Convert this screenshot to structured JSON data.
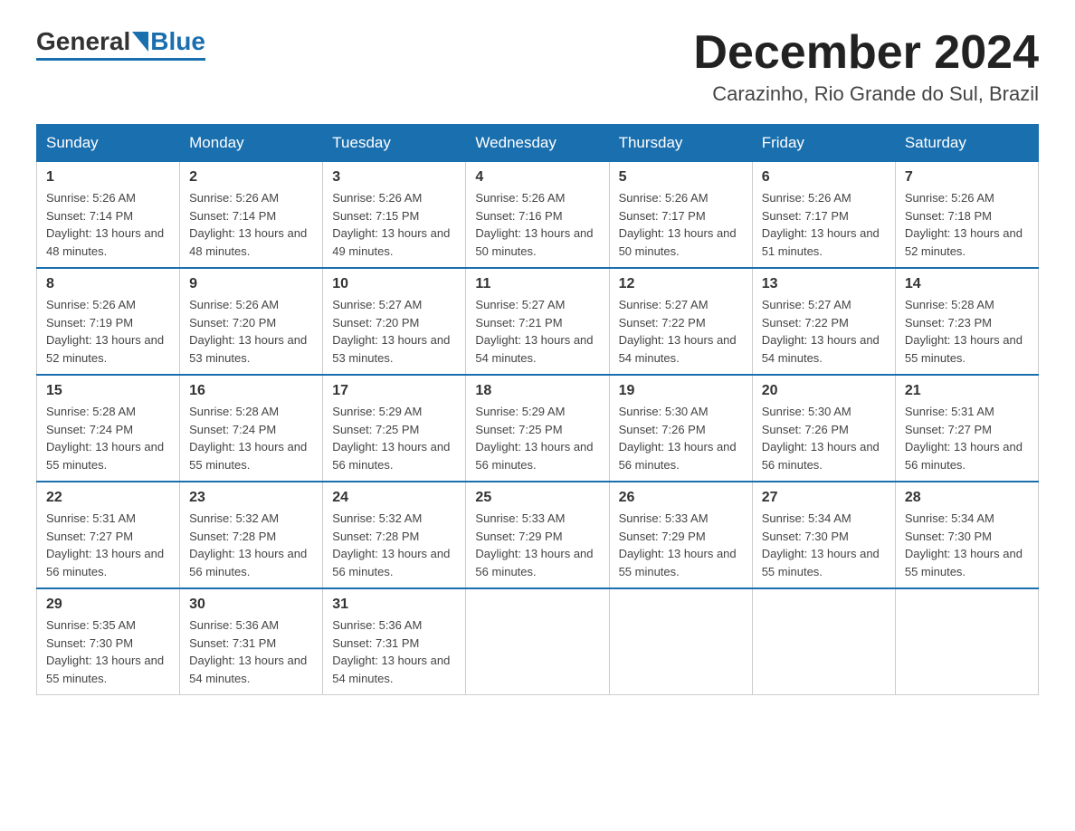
{
  "header": {
    "logo_general": "General",
    "logo_blue": "Blue",
    "month_title": "December 2024",
    "location": "Carazinho, Rio Grande do Sul, Brazil"
  },
  "days_of_week": [
    "Sunday",
    "Monday",
    "Tuesday",
    "Wednesday",
    "Thursday",
    "Friday",
    "Saturday"
  ],
  "weeks": [
    [
      {
        "num": "1",
        "sunrise": "5:26 AM",
        "sunset": "7:14 PM",
        "daylight": "13 hours and 48 minutes."
      },
      {
        "num": "2",
        "sunrise": "5:26 AM",
        "sunset": "7:14 PM",
        "daylight": "13 hours and 48 minutes."
      },
      {
        "num": "3",
        "sunrise": "5:26 AM",
        "sunset": "7:15 PM",
        "daylight": "13 hours and 49 minutes."
      },
      {
        "num": "4",
        "sunrise": "5:26 AM",
        "sunset": "7:16 PM",
        "daylight": "13 hours and 50 minutes."
      },
      {
        "num": "5",
        "sunrise": "5:26 AM",
        "sunset": "7:17 PM",
        "daylight": "13 hours and 50 minutes."
      },
      {
        "num": "6",
        "sunrise": "5:26 AM",
        "sunset": "7:17 PM",
        "daylight": "13 hours and 51 minutes."
      },
      {
        "num": "7",
        "sunrise": "5:26 AM",
        "sunset": "7:18 PM",
        "daylight": "13 hours and 52 minutes."
      }
    ],
    [
      {
        "num": "8",
        "sunrise": "5:26 AM",
        "sunset": "7:19 PM",
        "daylight": "13 hours and 52 minutes."
      },
      {
        "num": "9",
        "sunrise": "5:26 AM",
        "sunset": "7:20 PM",
        "daylight": "13 hours and 53 minutes."
      },
      {
        "num": "10",
        "sunrise": "5:27 AM",
        "sunset": "7:20 PM",
        "daylight": "13 hours and 53 minutes."
      },
      {
        "num": "11",
        "sunrise": "5:27 AM",
        "sunset": "7:21 PM",
        "daylight": "13 hours and 54 minutes."
      },
      {
        "num": "12",
        "sunrise": "5:27 AM",
        "sunset": "7:22 PM",
        "daylight": "13 hours and 54 minutes."
      },
      {
        "num": "13",
        "sunrise": "5:27 AM",
        "sunset": "7:22 PM",
        "daylight": "13 hours and 54 minutes."
      },
      {
        "num": "14",
        "sunrise": "5:28 AM",
        "sunset": "7:23 PM",
        "daylight": "13 hours and 55 minutes."
      }
    ],
    [
      {
        "num": "15",
        "sunrise": "5:28 AM",
        "sunset": "7:24 PM",
        "daylight": "13 hours and 55 minutes."
      },
      {
        "num": "16",
        "sunrise": "5:28 AM",
        "sunset": "7:24 PM",
        "daylight": "13 hours and 55 minutes."
      },
      {
        "num": "17",
        "sunrise": "5:29 AM",
        "sunset": "7:25 PM",
        "daylight": "13 hours and 56 minutes."
      },
      {
        "num": "18",
        "sunrise": "5:29 AM",
        "sunset": "7:25 PM",
        "daylight": "13 hours and 56 minutes."
      },
      {
        "num": "19",
        "sunrise": "5:30 AM",
        "sunset": "7:26 PM",
        "daylight": "13 hours and 56 minutes."
      },
      {
        "num": "20",
        "sunrise": "5:30 AM",
        "sunset": "7:26 PM",
        "daylight": "13 hours and 56 minutes."
      },
      {
        "num": "21",
        "sunrise": "5:31 AM",
        "sunset": "7:27 PM",
        "daylight": "13 hours and 56 minutes."
      }
    ],
    [
      {
        "num": "22",
        "sunrise": "5:31 AM",
        "sunset": "7:27 PM",
        "daylight": "13 hours and 56 minutes."
      },
      {
        "num": "23",
        "sunrise": "5:32 AM",
        "sunset": "7:28 PM",
        "daylight": "13 hours and 56 minutes."
      },
      {
        "num": "24",
        "sunrise": "5:32 AM",
        "sunset": "7:28 PM",
        "daylight": "13 hours and 56 minutes."
      },
      {
        "num": "25",
        "sunrise": "5:33 AM",
        "sunset": "7:29 PM",
        "daylight": "13 hours and 56 minutes."
      },
      {
        "num": "26",
        "sunrise": "5:33 AM",
        "sunset": "7:29 PM",
        "daylight": "13 hours and 55 minutes."
      },
      {
        "num": "27",
        "sunrise": "5:34 AM",
        "sunset": "7:30 PM",
        "daylight": "13 hours and 55 minutes."
      },
      {
        "num": "28",
        "sunrise": "5:34 AM",
        "sunset": "7:30 PM",
        "daylight": "13 hours and 55 minutes."
      }
    ],
    [
      {
        "num": "29",
        "sunrise": "5:35 AM",
        "sunset": "7:30 PM",
        "daylight": "13 hours and 55 minutes."
      },
      {
        "num": "30",
        "sunrise": "5:36 AM",
        "sunset": "7:31 PM",
        "daylight": "13 hours and 54 minutes."
      },
      {
        "num": "31",
        "sunrise": "5:36 AM",
        "sunset": "7:31 PM",
        "daylight": "13 hours and 54 minutes."
      },
      null,
      null,
      null,
      null
    ]
  ]
}
